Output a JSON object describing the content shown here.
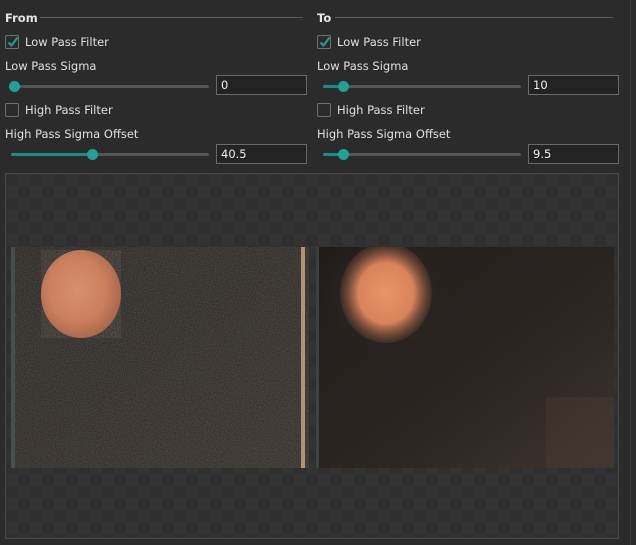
{
  "from": {
    "title": "From",
    "low_pass_filter": {
      "label": "Low Pass Filter",
      "checked": true
    },
    "low_pass_sigma": {
      "label": "Low Pass Sigma",
      "value": "0",
      "slider_fraction": 0.0
    },
    "high_pass_filter": {
      "label": "High Pass Filter",
      "checked": false
    },
    "high_pass_sigma_offset": {
      "label": "High Pass Sigma Offset",
      "value": "40.5",
      "slider_fraction": 0.41
    }
  },
  "to": {
    "title": "To",
    "low_pass_filter": {
      "label": "Low Pass Filter",
      "checked": true
    },
    "low_pass_sigma": {
      "label": "Low Pass Sigma",
      "value": "10",
      "slider_fraction": 0.1
    },
    "high_pass_filter": {
      "label": "High Pass Filter",
      "checked": false
    },
    "high_pass_sigma_offset": {
      "label": "High Pass Sigma Offset",
      "value": "9.5",
      "slider_fraction": 0.1
    }
  },
  "colors": {
    "accent": "#1aa396",
    "background": "#2b2b2b"
  },
  "icons": {
    "check": "check-icon"
  }
}
